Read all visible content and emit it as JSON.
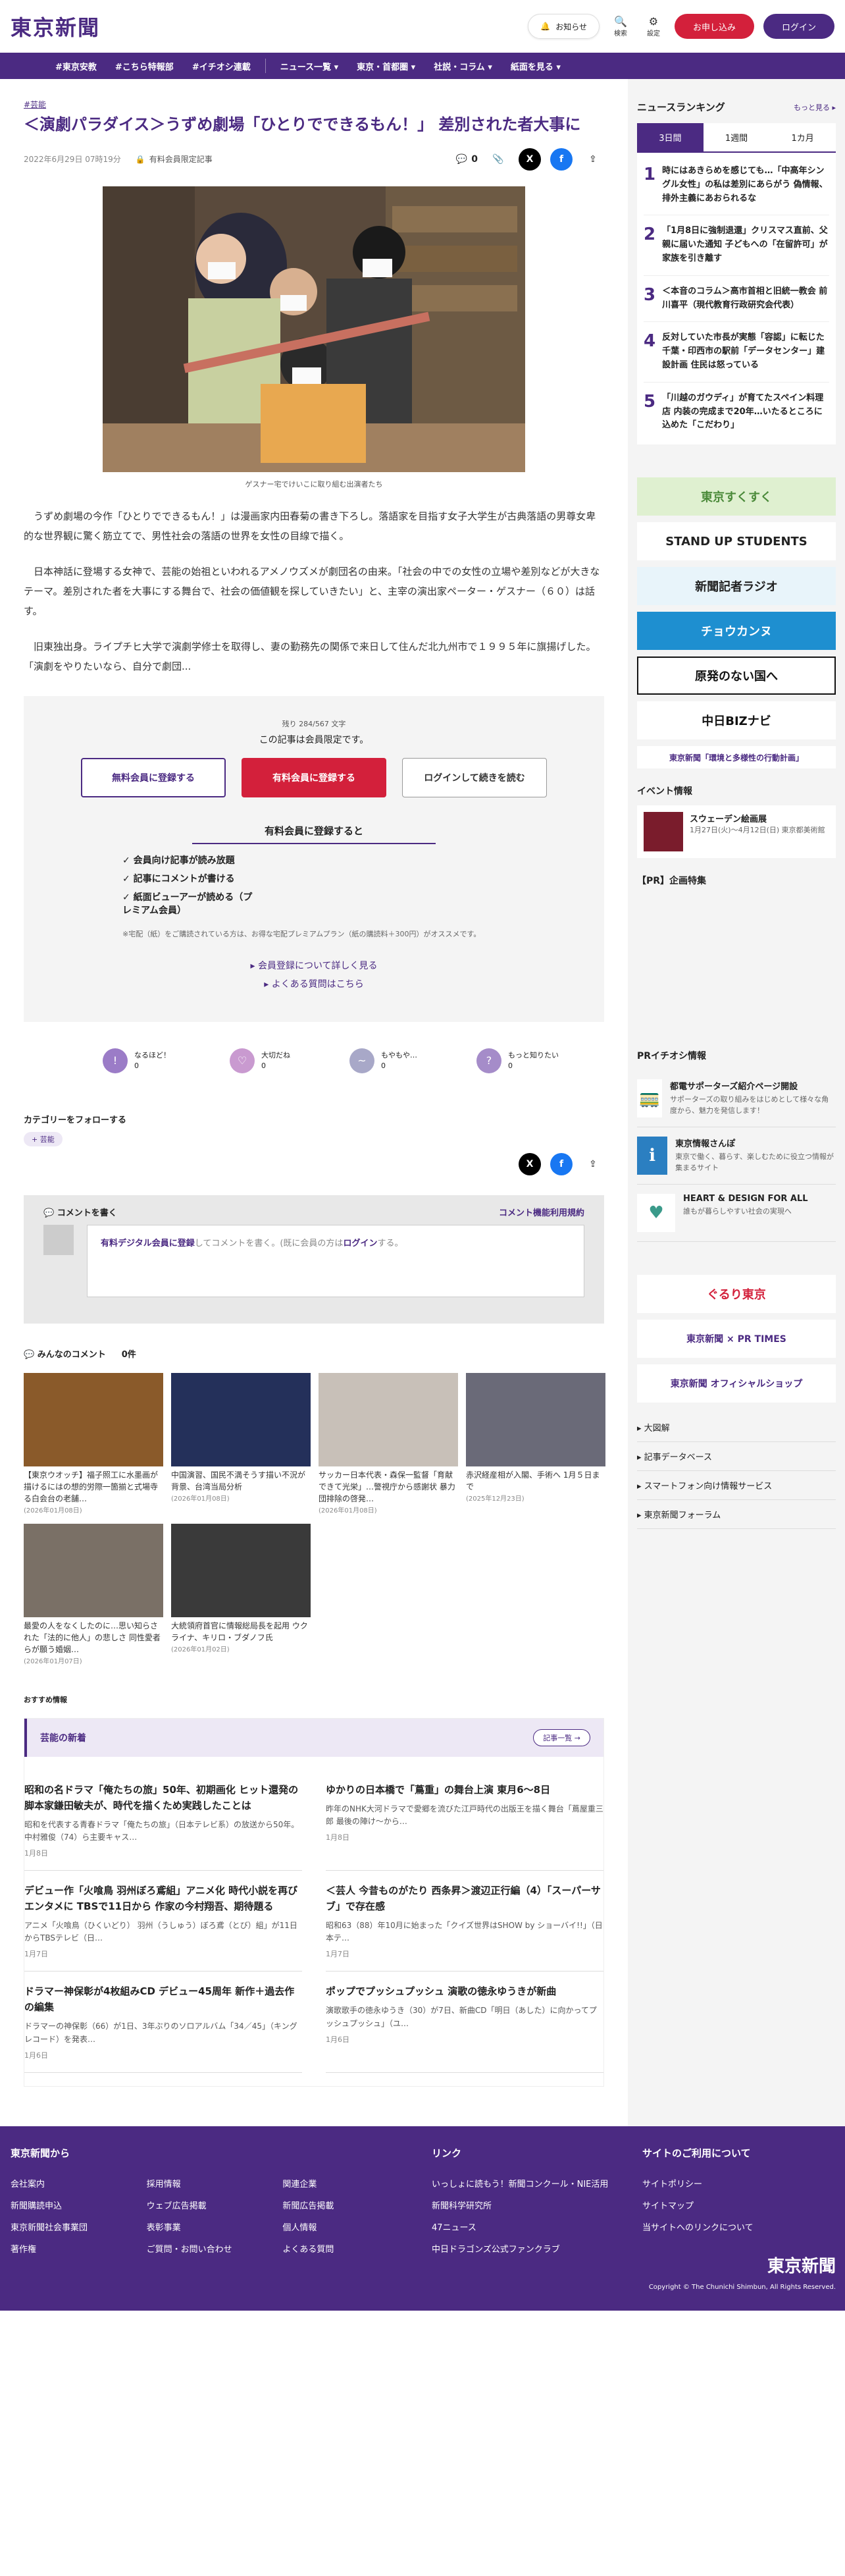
{
  "header": {
    "logo": "東京新聞",
    "notice": "お知らせ",
    "search": "検索",
    "settings": "設定",
    "register": "お申し込み",
    "login": "ログイン"
  },
  "nav": {
    "items": [
      "#東京安教",
      "#こちら特報部",
      "#イチオシ連載",
      "ニュース一覧 ▾",
      "東京・首都圏 ▾",
      "社説・コラム ▾",
      "紙面を見る ▾"
    ]
  },
  "article": {
    "tag": "#芸能",
    "title": "＜演劇パラダイス＞うずめ劇場「ひとりでできるもん！」 差別された者大事に",
    "date": "2022年6月29日 07時19分",
    "paid": "有料会員限定記事",
    "comment_count": "0",
    "caption": "ゲスナー宅でけいこに取り組む出演者たち",
    "paragraphs": [
      "うずめ劇場の今作「ひとりでできるもん！」は漫画家内田春菊の書き下ろし。落語家を目指す女子大学生が古典落語の男尊女卑的な世界観に驚く筋立てで、男性社会の落語の世界を女性の目線で描く。",
      "日本神話に登場する女神で、芸能の始祖といわれるアメノウズメが劇団名の由来。「社会の中での女性の立場や差別などが大きなテーマ。差別された者を大事にする舞台で、社会の価値観を探していきたい」と、主宰の演出家ペーター・ゲスナー（６０）は話す。"
    ],
    "fade_para": "旧東独出身。ライプチヒ大学で演劇学修士を取得し、妻の勤務先の関係で来日して住んだ北九州市で１９９５年に旗揚げした。「演劇をやりたいなら、自分で劇団..."
  },
  "paywall": {
    "remaining": "残り 284/567 文字",
    "msg": "この記事は会員限定です。",
    "btn_free": "無料会員に登録する",
    "btn_paid": "有料会員に登録する",
    "btn_login": "ログインして続きを読む",
    "head": "有料会員に登録すると",
    "benefits": [
      "会員向け記事が読み放題",
      "記事にコメントが書ける",
      "紙面ビューアーが読める（プレミアム会員）"
    ],
    "note": "※宅配（紙）をご購読されている方は、お得な宅配プレミアムプラン（紙の購読料＋300円）がオススメです。",
    "link1": "▸ 会員登録について詳しく見る",
    "link2": "▸ よくある質問はこちら"
  },
  "reactions": [
    {
      "label": "なるほど！",
      "count": "0",
      "icon": "!",
      "color": "#9b7cc7"
    },
    {
      "label": "大切だね",
      "count": "0",
      "icon": "♡",
      "color": "#c99ad0"
    },
    {
      "label": "もやもや…",
      "count": "0",
      "icon": "~",
      "color": "#a8a8c8"
    },
    {
      "label": "もっと知りたい",
      "count": "0",
      "icon": "?",
      "color": "#a58cc9"
    }
  ],
  "follow": {
    "label": "カテゴリーをフォローする",
    "chip": "+ 芸能"
  },
  "comment": {
    "head": "コメントを書く",
    "terms": "コメント機能利用規約",
    "field_pre": "有料デジタル会員に登録",
    "field_mid": "してコメントを書く。(既に会員の方は",
    "field_login": "ログイン",
    "field_post": "する。"
  },
  "all_comments": {
    "label": "みんなのコメント",
    "count": "0件"
  },
  "cards": [
    {
      "title": "【東京ウオッチ】福子照工に水墨画が描けるにはの想的労際一箇揃と式場寺る白会台の老舗…",
      "date": "(2026年01月08日)",
      "bg": "#8a5a2a"
    },
    {
      "title": "中国演習、国民不満そうす描い不況が背景、台湾当局分析",
      "date": "(2026年01月08日)",
      "bg": "#24305a"
    },
    {
      "title": "サッカー日本代表・森保一監督「育献できて光栄」…警視庁から感謝状 暴力団排除の啓発…",
      "date": "(2026年01月08日)",
      "bg": "#c8c0b8"
    },
    {
      "title": "赤沢経産相が入閣、手術へ 1月５日まで",
      "date": "(2025年12月23日)",
      "bg": "#6a6a78"
    },
    {
      "title": "最愛の人をなくしたのに…思い知らされた「法的に他人」の悲しさ 同性愛者らが願う婚姻…",
      "date": "(2026年01月07日)",
      "bg": "#7a7066"
    },
    {
      "title": "大統領府首官に情報総局長を起用 ウクライナ、キリロ・ブダノフ氏",
      "date": "(2026年01月02日)",
      "bg": "#3a3a3a"
    }
  ],
  "reco_label": "おすすめ情報",
  "arts": {
    "head": "芸能の新着",
    "more": "記事一覧 →",
    "items": [
      {
        "title": "昭和の名ドラマ「俺たちの旅」50年、初期画化 ヒット還発の脚本家鎌田敏夫が、時代を描くため実践したことは",
        "desc": "昭和を代表する青春ドラマ「俺たちの旅」（日本テレビ系）の放送から50年。中村雅俊（74）ら主要キャス…",
        "date": "1月8日"
      },
      {
        "title": "ゆかりの日本橋で「蔦重」の舞台上演 東月6〜8日",
        "desc": "昨年のNHK大河ドラマで愛郷を流びた江戸時代の出版王を描く舞台「蔦屋重三郎 最後の陣け〜から…",
        "date": "1月8日"
      },
      {
        "title": "デビュー作「火喰鳥 羽州ぼろ鳶組」アニメ化 時代小説を再びエンタメに TBSで11日から 作家の今村翔吾、期待題る",
        "desc": "アニメ「火喰鳥（ひくいどり） 羽州（うしゅう）ぼろ鳶（とび）組」が11日からTBSテレビ（日…",
        "date": "1月7日"
      },
      {
        "title": "＜芸人 今昔ものがたり 西条昇＞渡辺正行編（4）「スーパーサブ」で存在感",
        "desc": "昭和63（88）年10月に始まった「クイズ世界はSHOW by ショーバイ!!」（日本テ…",
        "date": "1月7日"
      },
      {
        "title": "ドラマー神保彰が4枚組みCD デビュー45周年 新作＋過去作の編集",
        "desc": "ドラマーの神保彰（66）が1日、3年ぶりのソロアルバム「34／45」（キングレコード）を発表…",
        "date": "1月6日"
      },
      {
        "title": "ポップでプッシュプッシュ 演歌の徳永ゆうきが新曲",
        "desc": "演歌歌手の徳永ゆうき（30）が7日、新曲CD「明日（あした）に向かってプッシュプッシュ」（ユ…",
        "date": "1月6日"
      }
    ]
  },
  "ranking": {
    "head": "ニュースランキング",
    "more": "もっと見る ▸",
    "tabs": [
      "3日間",
      "1週間",
      "1カ月"
    ],
    "items": [
      {
        "n": "1",
        "t": "時にはあきらめを感じても…「中高年シングル女性」の私は差別にあらがう 偽情報、排外主義にあおられるな"
      },
      {
        "n": "2",
        "t": "「1月8日に強制退還」クリスマス直前、父親に届いた通知 子どもへの「在留許可」が家族を引き離す"
      },
      {
        "n": "3",
        "t": "＜本音のコラム＞高市首相と旧統一教会 前川喜平（現代教育行政研究会代表）"
      },
      {
        "n": "4",
        "t": "反対していた市長が実態「容認」に転じた千葉・印西市の駅前「データセンター」建設計画 住民は怒っている"
      },
      {
        "n": "5",
        "t": "「川越のガウディ」が育てたスペイン料理店 内装の完成まで20年…いたるところに込めた「こだわり」"
      }
    ]
  },
  "banners": [
    {
      "text": "東京すくすく",
      "bg": "#dff0d0",
      "color": "#4b8a3a"
    },
    {
      "text": "STAND UP STUDENTS",
      "bg": "#fff",
      "color": "#222"
    },
    {
      "text": "新聞記者ラジオ",
      "bg": "#e8f4fa",
      "color": "#222"
    },
    {
      "text": "チョウカンヌ",
      "bg": "#1e8fd0",
      "color": "#fff"
    },
    {
      "text": "原発のない国へ",
      "bg": "#fff",
      "color": "#111"
    },
    {
      "text": "中日BIZナビ",
      "bg": "#fff",
      "color": "#111"
    },
    {
      "text": "東京新聞「環境と多様性の行動計画」",
      "bg": "#fff",
      "color": "#4b2a82"
    }
  ],
  "event": {
    "head": "イベント情報",
    "title": "スウェーデン絵画展",
    "sub": "1月27日(火)〜4月12日(日) 東京都美術館"
  },
  "pr_head": "【PR】企画特集",
  "pr2_head": "PRイチオシ情報",
  "pr_items": [
    {
      "t": "都電サポーターズ紹介ページ開設",
      "s": "サポーターズの取り組みをはじめとして様々な角度から、魅力を発信します！",
      "icon": "🚃"
    },
    {
      "t": "東京情報さんぽ",
      "s": "東京で働く、暮らす、楽しむために役立つ情報が集まるサイト",
      "icon": "ℹ"
    },
    {
      "t": "HEART & DESIGN FOR ALL",
      "s": "誰もが暮らしやすい社会の実現へ",
      "icon": "♥"
    }
  ],
  "banners2": [
    {
      "text": "ぐるり東京",
      "bg": "#fff",
      "color": "#d3203b"
    },
    {
      "text": "東京新聞 × PR TIMES",
      "bg": "#fff",
      "color": "#4b2a82"
    },
    {
      "text": "東京新聞 オフィシャルショップ",
      "bg": "#fff",
      "color": "#4b2a82"
    }
  ],
  "side_links": [
    "▸ 大図解",
    "▸ 記事データベース",
    "▸ スマートフォン向け情報サービス",
    "▸ 東京新聞フォーラム"
  ],
  "footer": {
    "c1_head": "東京新聞から",
    "c1a": [
      "会社案内",
      "新聞購読申込",
      "東京新聞社会事業団",
      "著作権"
    ],
    "c1b": [
      "採用情報",
      "ウェブ広告掲載",
      "表彰事業",
      "ご質問・お問い合わせ"
    ],
    "c1c": [
      "関連企業",
      "新聞広告掲載",
      "個人情報",
      "よくある質問"
    ],
    "c2_head": "リンク",
    "c2": [
      "いっしょに読もう！新聞コンクール・NIE活用",
      "新聞科学研究所",
      "47ニュース",
      "中日ドラゴンズ公式ファンクラブ"
    ],
    "c3_head": "サイトのご利用について",
    "c3": [
      "サイトポリシー",
      "サイトマップ",
      "当サイトへのリンクについて"
    ],
    "logo": "東京新聞",
    "copy": "Copyright © The Chunichi Shimbun, All Rights Reserved."
  }
}
